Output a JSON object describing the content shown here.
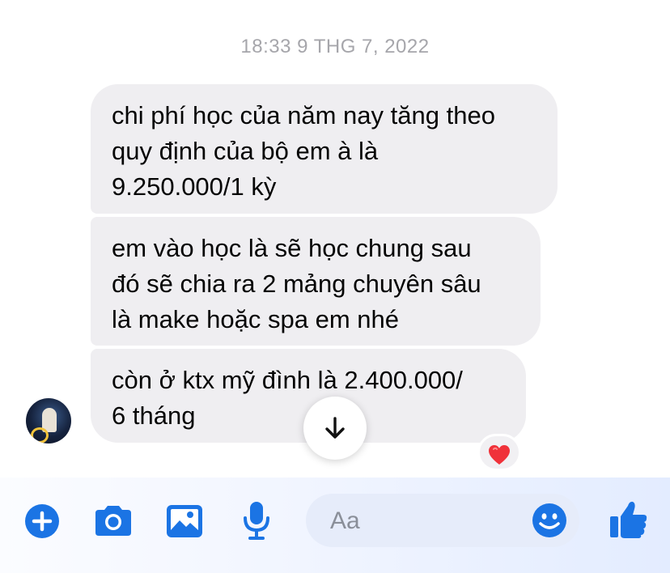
{
  "conversation": {
    "timestamp": "18:33 9 THG 7, 2022",
    "messages": [
      {
        "lines": [
          "chi phí học của năm nay tăng theo",
          "quy định của bộ em à là",
          "9.250.000/1 kỳ"
        ]
      },
      {
        "lines": [
          "em vào học là sẽ học chung sau",
          "đó sẽ chia ra 2 mảng chuyên sâu",
          "là make hoặc spa em nhé"
        ]
      },
      {
        "lines": [
          "còn ở ktx mỹ đình là 2.400.000/",
          "6 tháng"
        ],
        "reaction": "❤️"
      }
    ]
  },
  "composer": {
    "placeholder": "Aa",
    "icons": [
      "plus-icon",
      "camera-icon",
      "gallery-icon",
      "microphone-icon",
      "emoji-icon",
      "thumbs-up-icon"
    ]
  },
  "colors": {
    "accent": "#1b74e4",
    "bubble": "#efeef1",
    "timestamp": "#a6a6ab"
  }
}
